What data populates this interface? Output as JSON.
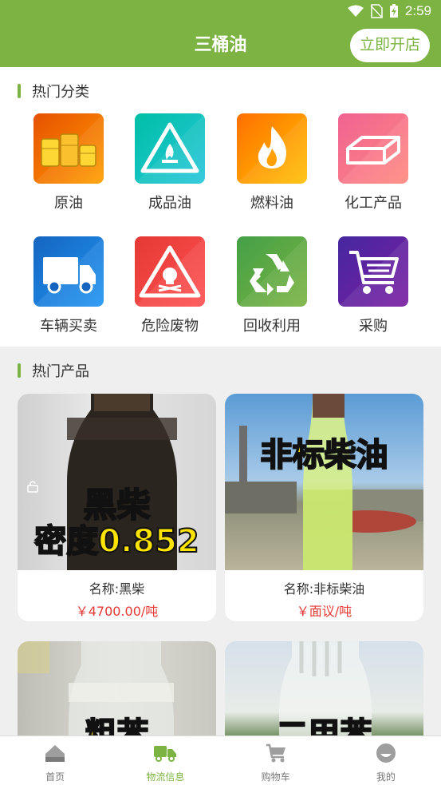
{
  "status": {
    "time": "2:59"
  },
  "appbar": {
    "title": "三桶油",
    "open_store": "立即开店"
  },
  "categories": {
    "heading": "热门分类",
    "items": [
      {
        "label": "原油",
        "icon": "oil-barrels-icon"
      },
      {
        "label": "成品油",
        "icon": "hazard-triangle-icon"
      },
      {
        "label": "燃料油",
        "icon": "flame-icon"
      },
      {
        "label": "化工产品",
        "icon": "brick-block-icon"
      },
      {
        "label": "车辆买卖",
        "icon": "truck-icon"
      },
      {
        "label": "危险废物",
        "icon": "skull-warning-icon"
      },
      {
        "label": "回收利用",
        "icon": "recycle-icon"
      },
      {
        "label": "采购",
        "icon": "shopping-cart-icon"
      }
    ],
    "colors": {
      "accent": "#7cb342"
    }
  },
  "products": {
    "heading": "热门产品",
    "items": [
      {
        "name": "名称:黑柴",
        "price": "￥4700.00/吨",
        "overlay1": "黑柴",
        "overlay2": "密度0.852"
      },
      {
        "name": "名称:非标柴油",
        "price": "￥面议/吨",
        "overlay1": "非标柴油"
      },
      {
        "overlay1": "粗苯"
      },
      {
        "overlay1": "二甲苯"
      }
    ]
  },
  "tabs": [
    {
      "label": "首页",
      "icon": "home-icon"
    },
    {
      "label": "物流信息",
      "icon": "delivery-truck-icon"
    },
    {
      "label": "购物车",
      "icon": "cart-icon"
    },
    {
      "label": "我的",
      "icon": "profile-icon"
    }
  ]
}
